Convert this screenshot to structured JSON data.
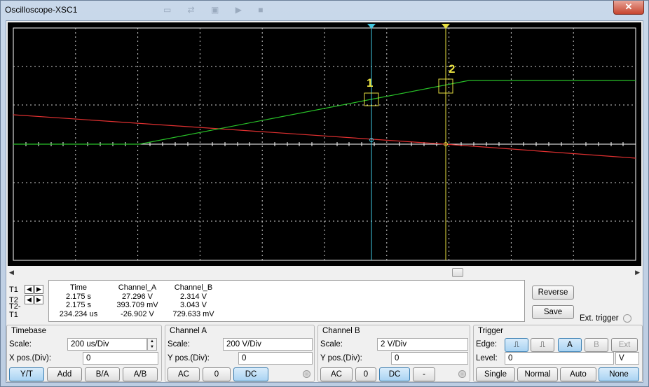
{
  "window": {
    "title": "Oscilloscope-XSC1",
    "close_label": "✕"
  },
  "cursors": {
    "label1": "1",
    "label2": "2"
  },
  "readout": {
    "rows": [
      "T1",
      "T2",
      "T2-T1"
    ],
    "headers": {
      "time": "Time",
      "a": "Channel_A",
      "b": "Channel_B"
    },
    "time": [
      "2.175 s",
      "2.175 s",
      "234.234 us"
    ],
    "channel_a": [
      "27.296 V",
      "393.709 mV",
      "-26.902 V"
    ],
    "channel_b": [
      "2.314 V",
      "3.043 V",
      "729.633 mV"
    ]
  },
  "buttons": {
    "reverse": "Reverse",
    "save": "Save",
    "ext_trigger": "Ext. trigger"
  },
  "timebase": {
    "title": "Timebase",
    "scale_label": "Scale:",
    "scale_value": "200 us/Div",
    "xpos_label": "X pos.(Div):",
    "xpos_value": "0",
    "modes": [
      "Y/T",
      "Add",
      "B/A",
      "A/B"
    ]
  },
  "channel_a": {
    "title": "Channel A",
    "scale_label": "Scale:",
    "scale_value": "200  V/Div",
    "ypos_label": "Y pos.(Div):",
    "ypos_value": "0",
    "coupling": [
      "AC",
      "0",
      "DC"
    ]
  },
  "channel_b": {
    "title": "Channel B",
    "scale_label": "Scale:",
    "scale_value": "2  V/Div",
    "ypos_label": "Y pos.(Div):",
    "ypos_value": "0",
    "coupling": [
      "AC",
      "0",
      "DC",
      "-"
    ]
  },
  "trigger": {
    "title": "Trigger",
    "edge_label": "Edge:",
    "source": [
      "A",
      "B",
      "Ext"
    ],
    "level_label": "Level:",
    "level_value": "0",
    "level_unit": "V",
    "modes": [
      "Single",
      "Normal",
      "Auto",
      "None"
    ]
  },
  "colors": {
    "channel_a": "#e03030",
    "channel_b": "#28c028",
    "cursor1": "#40c8e0",
    "cursor2": "#e8e040",
    "active_button": "#a9d3f2"
  }
}
